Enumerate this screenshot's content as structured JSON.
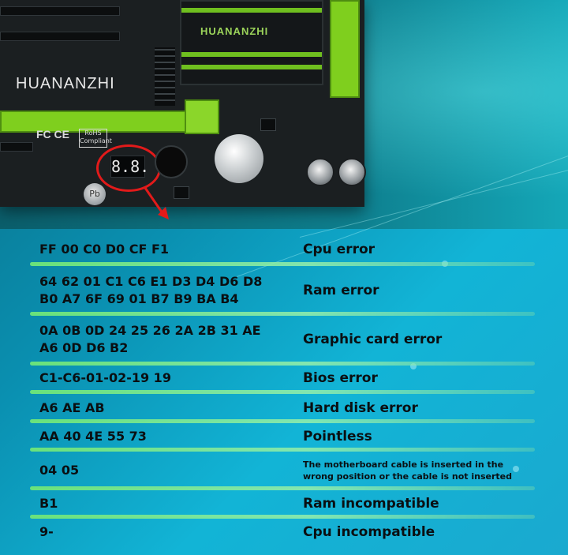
{
  "board": {
    "brand": "HUANANZHI",
    "heatsink_brand": "HUANANZHI",
    "cert_mark": "FC CE",
    "rohs_label": "RoHS Compliant",
    "debug_display_text": "8.8.",
    "battery_label": "Pb",
    "colors": {
      "pcb": "#1b1f21",
      "slot_green": "#7fcf1e",
      "highlight_red": "#e21a1a"
    }
  },
  "errors": [
    {
      "code_lines": [
        "FF 00 C0 D0 CF F1"
      ],
      "description": "Cpu error"
    },
    {
      "code_lines": [
        "64 62 01 C1 C6 E1 D3 D4 D6 D8",
        "B0 A7 6F 69 01 B7 B9 BA B4"
      ],
      "description": "Ram error"
    },
    {
      "code_lines": [
        "0A 0B 0D 24 25 26 2A 2B 31 AE",
        "A6 0D D6 B2"
      ],
      "description": "Graphic card error"
    },
    {
      "code_lines": [
        "C1-C6-01-02-19 19"
      ],
      "description": "Bios error"
    },
    {
      "code_lines": [
        "A6 AE AB"
      ],
      "description": "Hard disk error"
    },
    {
      "code_lines": [
        "AA 40 4E 55 73"
      ],
      "description": "Pointless"
    },
    {
      "code_lines": [
        "04 05"
      ],
      "description_lines": [
        "The motherboard cable is inserted in the",
        "wrong position or the cable is not inserted"
      ]
    },
    {
      "code_lines": [
        "B1"
      ],
      "description": "Ram incompatible"
    },
    {
      "code_lines": [
        "9-"
      ],
      "description": "Cpu incompatible"
    }
  ],
  "colors": {
    "background_start": "#0b6f86",
    "background_end": "#12b4d6",
    "separator": "#6ee678",
    "text": "#0a0f12"
  }
}
